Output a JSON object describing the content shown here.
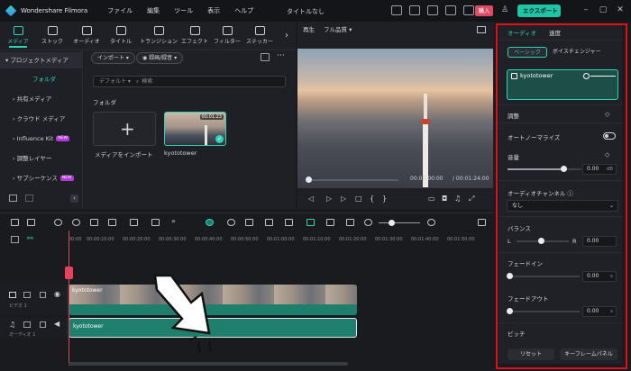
{
  "app": {
    "name": "Wondershare Filmora",
    "project_title": "タイトルなし"
  },
  "menu": [
    "ファイル",
    "編集",
    "ツール",
    "表示",
    "ヘルプ"
  ],
  "topbar": {
    "buy_label": "購入",
    "export_label": "エクスポート ▾"
  },
  "media_tabs": [
    {
      "label": "メディア",
      "active": true
    },
    {
      "label": "ストック"
    },
    {
      "label": "オーディオ"
    },
    {
      "label": "タイトル"
    },
    {
      "label": "トランジション"
    },
    {
      "label": "エフェクト"
    },
    {
      "label": "フィルター"
    },
    {
      "label": "ステッカー"
    }
  ],
  "sidebar": {
    "items": [
      {
        "label": "▾ プロジェクトメディア",
        "kind": "head"
      },
      {
        "label": "フォルダ",
        "kind": "sel"
      },
      {
        "label": "› 共有メディア"
      },
      {
        "label": "› クラウド メディア"
      },
      {
        "label": "› Influence Kit",
        "badge": "NEW"
      },
      {
        "label": "› 調整レイヤー"
      },
      {
        "label": "› サブシーケンス",
        "badge": "NEW"
      }
    ]
  },
  "media_area": {
    "import_button": "インポート ▾",
    "record_button": "◉ 録画/録音 ▾",
    "sort_label": "デフォルト ▾",
    "search_placeholder": "検索",
    "folder_label": "フォルダ",
    "import_caption": "メディアをインポート",
    "video_caption": "kyototower",
    "video_duration": "00:01:23"
  },
  "player": {
    "tab_label": "再生",
    "quality": "フル品質 ▾",
    "current_time": "00:00:00:00",
    "total_time": "/ 00:01:24:00"
  },
  "inspector": {
    "tabs": [
      {
        "label": "オーディオ",
        "active": true
      },
      {
        "label": "速度"
      }
    ],
    "subtabs": [
      {
        "label": "ベーシック",
        "active": true
      },
      {
        "label": "ボイスチェンジャー"
      }
    ],
    "track_name": "kyototower",
    "adjust_label": "調整",
    "autonormalize_label": "オートノーマライズ",
    "volume_label": "音量",
    "volume_value": "0.00",
    "volume_unit": "dB",
    "channel_label": "オーディオチャンネル ⓘ",
    "channel_value": "なし",
    "balance_label": "バランス",
    "balance_left": "L",
    "balance_right": "R",
    "balance_value": "0.00",
    "fadein_label": "フェードイン",
    "fadein_value": "0.00",
    "fadein_unit": "s",
    "fadeout_label": "フェードアウト",
    "fadeout_value": "0.00",
    "fadeout_unit": "s",
    "pitch_label": "ピッチ",
    "reset_button": "リセット",
    "keyframe_button": "キーフレームパネル"
  },
  "timeline": {
    "ruler_ticks": [
      "00:00",
      "00:00:10:00",
      "00:00:20:00",
      "00:00:30:00",
      "00:00:40:00",
      "00:00:50:00",
      "00:01:00:00",
      "00:01:10:00",
      "00:01:20:00",
      "00:01:30:00",
      "00:01:40:00",
      "00:01:50:00"
    ],
    "video_track_label": "ビデオ 1",
    "audio_track_label": "オーディオ 1",
    "video_clip_name": "kyototower",
    "audio_clip_name": "kyototower"
  }
}
